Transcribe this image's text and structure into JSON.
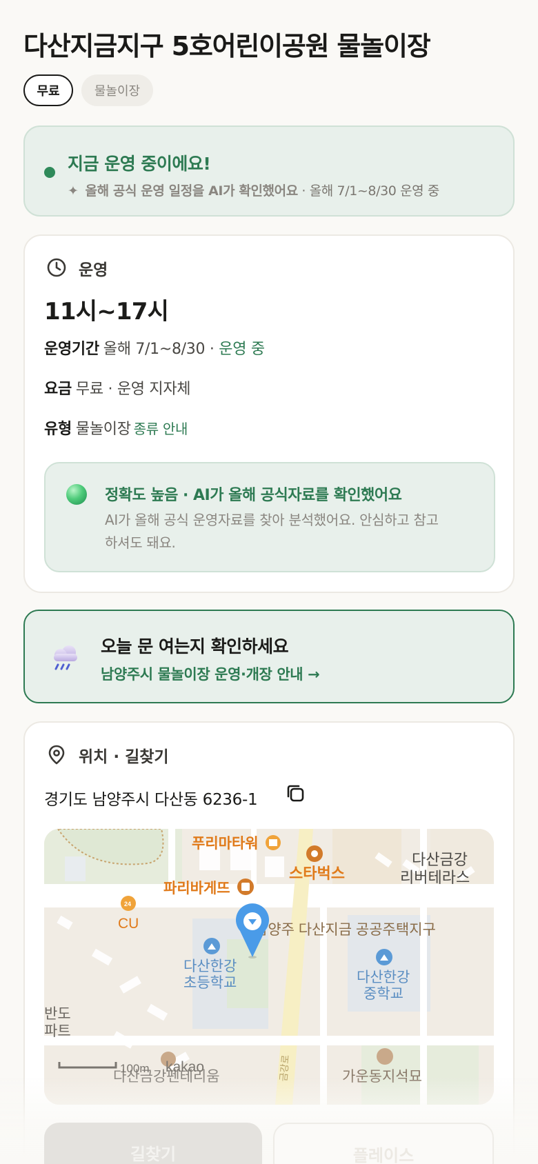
{
  "page": {
    "title": "다산지금지구 5호어린이공원 물놀이장",
    "tags": {
      "fee": "무료",
      "type": "물놀이장"
    }
  },
  "status": {
    "title": "지금 운영 중이에요!",
    "sparkle_icon": "sparkle-icon",
    "sub_strong": "올해 공식 운영 일정을 AI가 확인했어요",
    "sub_rest": " · 올해 7/1~8/30 운영 중"
  },
  "hours": {
    "section_title": "운영",
    "section_icon": "clock-icon",
    "time": "11시~17시",
    "period_label": "운영기간",
    "period_value": "올해 7/1~8/30 · ",
    "period_status": "운영 중",
    "fee_label": "요금",
    "fee_value": "무료 · 운영 지자체",
    "type_label": "유형",
    "type_value": "물놀이장",
    "type_link": "종류 안내"
  },
  "accuracy": {
    "title": "정확도 높음 · AI가 올해 공식자료를 확인했어요",
    "desc": "AI가 올해 공식 운영자료를 찾아 분석했어요. 안심하고 참고하셔도 돼요."
  },
  "notice": {
    "icon": "rain-cloud-icon",
    "title": "오늘 문 여는지 확인하세요",
    "link": "남양주시 물놀이장 운영·개장 안내 →"
  },
  "location": {
    "section_title": "위치 · 길찾기",
    "section_icon": "map-pin-icon",
    "address": "경기도 남양주시 다산동 6236-1",
    "copy_icon": "copy-icon",
    "map": {
      "labels": {
        "puri": "푸리마타워",
        "starbucks": "스타벅스",
        "dasan_river_1": "다산금강",
        "dasan_river_2": "리버테라스",
        "paris": "파리바게뜨",
        "cu": "CU",
        "housing": "남양주 다산지금 공공주택지구",
        "elem_1": "다산한강",
        "elem_2": "초등학교",
        "mid_1": "다산한강",
        "mid_2": "중학교",
        "bando_1": "반도",
        "bando_2": "파트",
        "scale": "100m",
        "kakao": "kakao",
        "bottom_left": "다산금강펜테리움",
        "bottom_right": "가운동지석묘",
        "road": "금강로"
      }
    }
  },
  "actions": {
    "directions": "길찾기",
    "place": "플레이스"
  },
  "colors": {
    "accent_green": "#2d7a52",
    "status_bg": "#e8f0eb",
    "map_pin": "#4a9be8",
    "map_orange": "#e07a1a"
  }
}
